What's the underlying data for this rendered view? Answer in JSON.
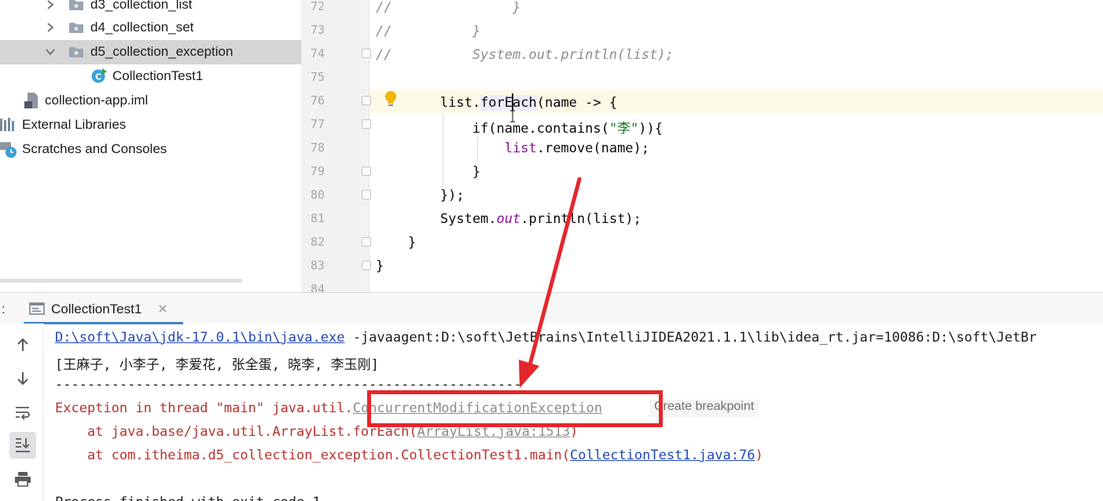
{
  "project_tree": {
    "items": [
      {
        "label": "d3_collection_list"
      },
      {
        "label": "d4_collection_set"
      },
      {
        "label": "d5_collection_exception"
      },
      {
        "label": "CollectionTest1"
      },
      {
        "label": "collection-app.iml"
      },
      {
        "label": "External Libraries"
      },
      {
        "label": "Scratches and Consoles"
      }
    ]
  },
  "editor": {
    "line_numbers": [
      "72",
      "73",
      "74",
      "75",
      "76",
      "77",
      "78",
      "79",
      "80",
      "81",
      "82",
      "83",
      "84"
    ]
  },
  "run": {
    "panel_prefix": ":",
    "tab_label": "CollectionTest1",
    "toolbar": [
      "up-arrow-icon",
      "down-arrow-icon",
      "soft-wrap-icon",
      "scroll-to-end-icon",
      "print-icon"
    ],
    "console": {
      "cmd_path": "D:\\soft\\Java\\jdk-17.0.1\\bin\\java.exe",
      "cmd_args": " -javaagent:D:\\soft\\JetBrains\\IntelliJIDEA2021.1.1\\lib\\idea_rt.jar=10086:D:\\soft\\JetBr",
      "output": "[王麻子, 小李子, 李爱花, 张全蛋, 晓李, 李玉刚]",
      "separator": "----------------------------------------------------------",
      "exception_prefix": "Exception in thread \"main\" java.util.",
      "exception_class": "ConcurrentModificationException",
      "create_breakpoint": "Create breakpoint",
      "trace1_prefix": "    at java.base/java.util.ArrayList.forEach(",
      "trace1_link": "ArrayList.java:1513",
      "trace1_suffix": ")",
      "trace2_prefix": "    at com.itheima.d5_collection_exception.CollectionTest1.main(",
      "trace2_link": "CollectionTest1.java:76",
      "trace2_suffix": ")",
      "exit_line": "Process finished with exit code 1"
    }
  },
  "colors": {
    "annotation": "#e5262d",
    "error_text": "#b8322f",
    "link": "#2147b5",
    "selection": "#d5d5d5",
    "current_line": "#fcfae6"
  }
}
